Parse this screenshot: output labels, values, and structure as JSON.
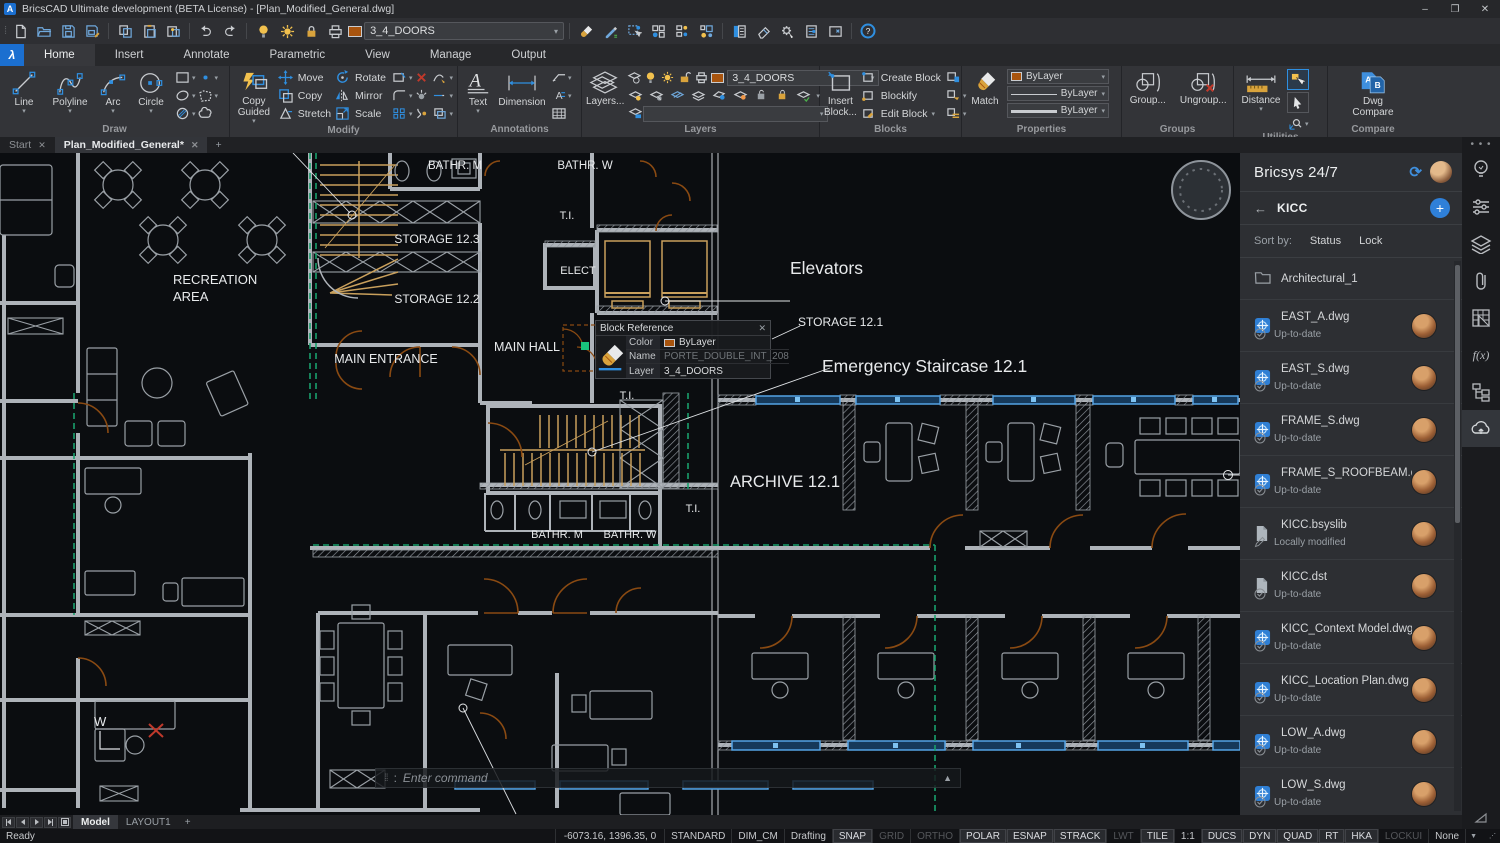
{
  "window": {
    "title": "BricsCAD Ultimate development (BETA License) - [Plan_Modified_General.dwg]",
    "logo": "A",
    "minimize": "–",
    "restore": "❐",
    "close": "✕"
  },
  "qat": {
    "layer_combo": "3_4_DOORS",
    "help": "?"
  },
  "ribbon": {
    "tabs": [
      {
        "label": "Home",
        "state": "active"
      },
      {
        "label": "Insert",
        "state": ""
      },
      {
        "label": "Annotate",
        "state": ""
      },
      {
        "label": "Parametric",
        "state": ""
      },
      {
        "label": "View",
        "state": ""
      },
      {
        "label": "Manage",
        "state": ""
      },
      {
        "label": "Output",
        "state": ""
      }
    ],
    "draw": {
      "title": "Draw",
      "line": "Line",
      "polyline": "Polyline",
      "arc": "Arc",
      "circle": "Circle"
    },
    "modify": {
      "title": "Modify",
      "copy_guided": "Copy Guided",
      "move": "Move",
      "copy": "Copy",
      "stretch": "Stretch",
      "rotate": "Rotate",
      "mirror": "Mirror",
      "scale": "Scale"
    },
    "annotations": {
      "title": "Annotations",
      "text": "Text",
      "dimension": "Dimension"
    },
    "layers": {
      "title": "Layers",
      "layers_btn": "Layers...",
      "combo": "3_4_DOORS"
    },
    "blocks": {
      "title": "Blocks",
      "insert": "Insert Block...",
      "create": "Create Block",
      "blockify": "Blockify",
      "edit": "Edit Block"
    },
    "properties": {
      "title": "Properties",
      "match": "Match",
      "bylayer1": "ByLayer",
      "bylayer2": "ByLayer",
      "bylayer3": "ByLayer"
    },
    "groups": {
      "title": "Groups",
      "group": "Group...",
      "ungroup": "Ungroup..."
    },
    "utilities": {
      "title": "Utilities",
      "distance": "Distance"
    },
    "compare": {
      "title": "Compare",
      "dwg_compare": "Dwg Compare"
    }
  },
  "doc_tabs": [
    {
      "label": "Start",
      "state": ""
    },
    {
      "label": "Plan_Modified_General*",
      "state": "active"
    }
  ],
  "canvas": {
    "labels": {
      "bathr_m_top": "BATHR. M",
      "bathr_w_top": "BATHR. W",
      "storage_123": "STORAGE 12.3",
      "storage_122": "STORAGE 12.2",
      "recreation_1": "RECREATION",
      "recreation_2": "AREA",
      "main_entrance": "MAIN ENTRANCE",
      "main_hall": "MAIN HALL",
      "ti_1": "T.I.",
      "ti_2": "T.I.",
      "ti_3": "T.I.",
      "elect": "ELECT",
      "elevators": "Elevators",
      "storage_121": "STORAGE 12.1",
      "emergency": "Emergency Staircase 12.1",
      "archive": "ARCHIVE 12.1",
      "bathr_m_bottom": "BATHR. M",
      "bathr_w_bottom": "BATHR. W",
      "w_marker": "W"
    },
    "tooltip": {
      "title": "Block Reference",
      "color_label": "Color",
      "color_value": "ByLayer",
      "name_label": "Name",
      "name_value": "PORTE_DOUBLE_INT_208",
      "layer_label": "Layer",
      "layer_value": "3_4_DOORS"
    },
    "command_line": "Enter command",
    "command_prompt": ":"
  },
  "right_panel": {
    "title": "Bricsys 24/7",
    "project": "KICC",
    "sort_label": "Sort by:",
    "sort_status": "Status",
    "sort_lock": "Lock",
    "files": [
      {
        "name": "Architectural_1",
        "icon": "folder",
        "badge": "",
        "status": ""
      },
      {
        "name": "EAST_A.dwg",
        "icon": "dwg",
        "badge": "check",
        "status": "Up-to-date"
      },
      {
        "name": "EAST_S.dwg",
        "icon": "dwg",
        "badge": "check",
        "status": "Up-to-date"
      },
      {
        "name": "FRAME_S.dwg",
        "icon": "dwg",
        "badge": "check",
        "status": "Up-to-date"
      },
      {
        "name": "FRAME_S_ROOFBEAM.dwg",
        "icon": "dwg",
        "badge": "check",
        "status": "Up-to-date"
      },
      {
        "name": "KICC.bsyslib",
        "icon": "file",
        "badge": "pencil",
        "status": "Locally modified"
      },
      {
        "name": "KICC.dst",
        "icon": "file",
        "badge": "check",
        "status": "Up-to-date"
      },
      {
        "name": "KICC_Context Model.dwg",
        "icon": "dwg",
        "badge": "check",
        "status": "Up-to-date"
      },
      {
        "name": "KICC_Location Plan.dwg",
        "icon": "dwg",
        "badge": "check",
        "status": "Up-to-date"
      },
      {
        "name": "LOW_A.dwg",
        "icon": "dwg",
        "badge": "check",
        "status": "Up-to-date"
      },
      {
        "name": "LOW_S.dwg",
        "icon": "dwg",
        "badge": "check",
        "status": "Up-to-date"
      }
    ]
  },
  "model_tabs": [
    {
      "label": "Model",
      "state": "active"
    },
    {
      "label": "LAYOUT1",
      "state": ""
    }
  ],
  "status_bar": {
    "ready": "Ready",
    "coords": "-6073.16, 1396.35, 0",
    "items": [
      {
        "label": "STANDARD",
        "state": "plain"
      },
      {
        "label": "DIM_CM",
        "state": "plain"
      },
      {
        "label": "Drafting",
        "state": "plain"
      },
      {
        "label": "SNAP",
        "state": "on"
      },
      {
        "label": "GRID",
        "state": "off"
      },
      {
        "label": "ORTHO",
        "state": "off"
      },
      {
        "label": "POLAR",
        "state": "on"
      },
      {
        "label": "ESNAP",
        "state": "on"
      },
      {
        "label": "STRACK",
        "state": "on"
      },
      {
        "label": "LWT",
        "state": "off"
      },
      {
        "label": "TILE",
        "state": "on"
      },
      {
        "label": "1:1",
        "state": "plain"
      },
      {
        "label": "DUCS",
        "state": "on"
      },
      {
        "label": "DYN",
        "state": "on"
      },
      {
        "label": "QUAD",
        "state": "on"
      },
      {
        "label": "RT",
        "state": "on"
      },
      {
        "label": "HKA",
        "state": "on"
      },
      {
        "label": "LOCKUI",
        "state": "off"
      },
      {
        "label": "None",
        "state": "plain"
      }
    ]
  },
  "colors": {
    "accent": "#2f8fe0",
    "gold": "#c9a05c",
    "door": "#8a4a12",
    "selection_green": "#19a06c",
    "window_blue": "#54a3e4",
    "swatch_orange": "#a8540e"
  }
}
